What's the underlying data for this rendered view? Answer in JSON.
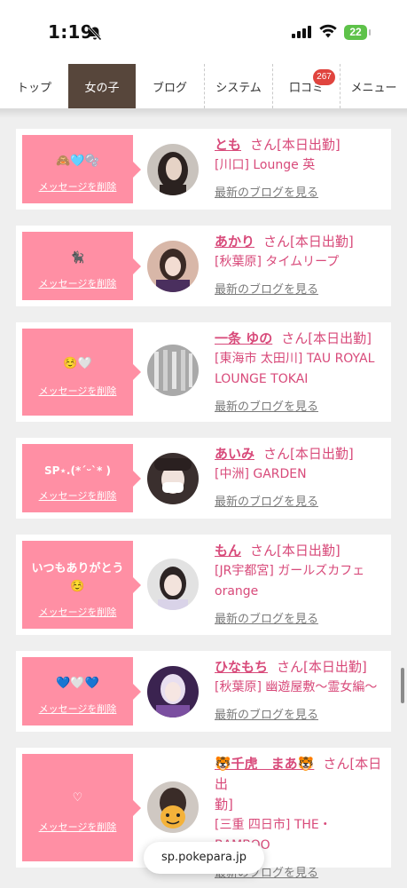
{
  "status_bar": {
    "time": "1:19",
    "battery": "22"
  },
  "tabs": [
    {
      "label": "トップ"
    },
    {
      "label": "女の子"
    },
    {
      "label": "ブログ"
    },
    {
      "label": "システム"
    },
    {
      "label": "口コミ"
    },
    {
      "label": "メニュー"
    }
  ],
  "reviews_badge": "267",
  "colors": {
    "accent": "#d84a7a",
    "message_box": "#ff8fa4",
    "active_tab": "#57463b",
    "badge": "#e0443e"
  },
  "delete_label": "メッセージを削除",
  "blog_link": "最新のブログを見る",
  "girls": [
    {
      "message": "🙈🩵🫧",
      "name": "とも",
      "san": "さん[本日出勤]",
      "shop_lines": [
        "[川口] Lounge 英"
      ]
    },
    {
      "message": "🐈‍⬛",
      "name": "あかり",
      "san": "さん[本日出勤]",
      "shop_lines": [
        "[秋葉原] タイムリープ"
      ]
    },
    {
      "message": "☺️🤍",
      "name": "一条 ゆの",
      "san": "さん[本日出勤]",
      "shop_lines": [
        "[東海市 太田川] TAU ROYAL",
        "LOUNGE TOKAI"
      ]
    },
    {
      "message": "SP⋆.(*ˊᵕˋ* )",
      "name": "あいみ",
      "san": "さん[本日出勤]",
      "shop_lines": [
        "[中洲] GARDEN"
      ]
    },
    {
      "message": "いつもありがとう ☺️",
      "name": "もん",
      "san": "さん[本日出勤]",
      "shop_lines": [
        "[JR宇都宮] ガールズカフェ",
        "orange"
      ]
    },
    {
      "message": "💙🤍💙",
      "name": "ひなもち",
      "san": "さん[本日出勤]",
      "shop_lines": [
        "[秋葉原] 幽遊屋敷〜霊女編〜"
      ]
    },
    {
      "message": "♡",
      "name": "🐯千虎　まあ🐯",
      "san_1": "さん[本日出",
      "san_2": "勤]",
      "shop_lines": [
        "[三重 四日市] THE・",
        "BAMBOO"
      ]
    }
  ],
  "url": "sp.pokepara.jp"
}
